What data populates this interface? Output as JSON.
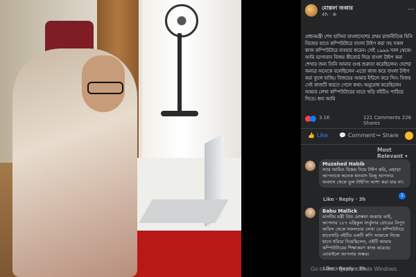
{
  "post": {
    "author": "মোস্তফা জব্বার",
    "time": "4h · ⊕",
    "more": "...",
    "body": "প্রধানমন্ত্রী শেখ হাসিনা বাংলাদেশের প্রথম রাজনীতিক যিনি নিজের হাতে কম্পিউটারে বাংলা টাইপ করা সহ সকল কাজ কম্পিউটারে ব্যবহার করেন। সেই ১৯৯৬ সাল থেকে। আমি ভাগ্যবান বিজয় কীবোর্ড দিয়ে বাংলা টাইপ করা শেখার জন্য তিনি আমার গুপ্ত শুরুতা করেছিলেন। দেশের অন্যত্র অনেকে বলেছিলেন এতো কাজ করে বাংলা টাইপ করা ফুলে যাচ্ছি। বিজয়ের আমার ইন্টলে করে দিন। বিজয় সেই কাজটি করতে গেলে কথা। অনুরোধ করেছিলেন আমার লেখা কম্পিউটারের হাতে খড়ি বইটিও পাঠিয়ে দিতে। ধন্য আমি",
    "reaction_count": "3.1K",
    "comment_count": "121 Comments",
    "share_count": "226 Shares",
    "actions": {
      "like": "Like",
      "comment": "Comment",
      "share": "Share"
    },
    "sort_label": "Most Relevant ▾"
  },
  "comments": [
    {
      "name": "Muzahed Habib",
      "text": "স্যার আমিও বিজয় দিয়ে টাইপ করি, এছাড়া আপনাকে অনেক ধন্যবাদ বিজু আপনার অবদান থেকে ভুল টাইপিং আশা করা যায় না।",
      "meta": "Like · Reply · 3h",
      "badge": "1"
    },
    {
      "name": "Babu Mallick",
      "text": "মাননীয় মন্ত্রী প্রিয় মোস্তফা জব্বার ভাই, আপনার ১৮৭ মন্ত্রিকুল সার্বুলার রোডের নিপুণ অফিস থেকে সফলতার লেখা যে কম্পিউটারে হাতেখড়ি বইটির একটি কপি আমাকে নিজে হাতে ধরিয়ে দিয়েছিলেন, ওইটি আমার কম্পিউটারের শিক্ষাকরণ কাজ করেছে। মোবাইলে আপনার অক্ষর।",
      "meta": "Like · Reply · 3h",
      "badge": ""
    }
  ],
  "watermark": "Go to Settings to activate Windows.",
  "colors": {
    "background": "#000000",
    "panel": "#242526",
    "bubble": "#3a3b3c",
    "link": "#2d88ff",
    "text": "#e4e6eb",
    "muted": "#b0b3b8",
    "table_red": "#b61916"
  },
  "icons": {
    "like": "thumbs-up-icon",
    "comment": "comment-icon",
    "share": "share-icon",
    "reaction_love": "heart-icon",
    "reaction_like": "like-icon"
  }
}
